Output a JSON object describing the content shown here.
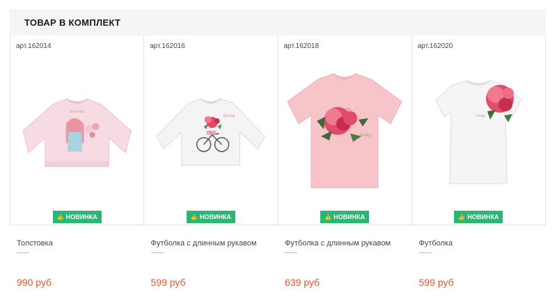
{
  "section": {
    "title": "ТОВАР В КОМПЛЕКТ"
  },
  "badge_label": "НОВИНКА",
  "colors": {
    "accent": "#2bb673",
    "price": "#e0562d",
    "header_bg": "#f5f5f5"
  },
  "products": [
    {
      "sku": "арт.162014",
      "name": "Толстовка",
      "price": "990 руб",
      "image": "pink-sweatshirt-girl-print"
    },
    {
      "sku": "арт.162016",
      "name": "Футболка с длинным рукавом",
      "price": "599 руб",
      "image": "white-longsleeve-bicycle-print"
    },
    {
      "sku": "арт.162018",
      "name": "Футболка с длинным рукавом",
      "price": "639 руб",
      "image": "pink-tshirt-rose-print"
    },
    {
      "sku": "арт.162020",
      "name": "Футболка",
      "price": "599 руб",
      "image": "white-tshirt-rose-print"
    }
  ]
}
